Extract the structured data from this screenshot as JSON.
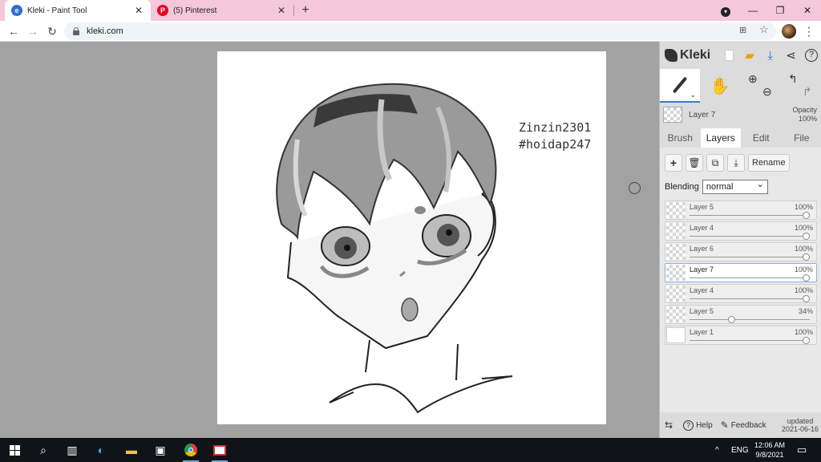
{
  "browser": {
    "tabs": [
      {
        "title": "Kleki - Paint Tool",
        "favicon": "kleki-favicon",
        "active": true
      },
      {
        "title": "(5) Pinterest",
        "favicon": "pinterest-favicon",
        "active": false
      }
    ],
    "url": "kleki.com",
    "accent_color": "#f4c7da"
  },
  "canvas": {
    "watermark_line1": "Zinzin2301",
    "watermark_line2": "#hoidap247"
  },
  "panel": {
    "logo_text": "Kleki",
    "current_layer": "Layer 7",
    "opacity_label": "Opacity",
    "opacity_value": "100%",
    "tabs": [
      "Brush",
      "Layers",
      "Edit",
      "File"
    ],
    "active_tab": "Layers",
    "rename_label": "Rename",
    "blending_label": "Blending",
    "blending_value": "normal",
    "layers": [
      {
        "name": "Layer 5",
        "opacity": "100%",
        "level": 1.0,
        "thumb": "checker"
      },
      {
        "name": "Layer 4",
        "opacity": "100%",
        "level": 1.0,
        "thumb": "checker"
      },
      {
        "name": "Layer 6",
        "opacity": "100%",
        "level": 1.0,
        "thumb": "checker"
      },
      {
        "name": "Layer 7",
        "opacity": "100%",
        "level": 1.0,
        "thumb": "checker",
        "selected": true
      },
      {
        "name": "Layer 4",
        "opacity": "100%",
        "level": 1.0,
        "thumb": "checker"
      },
      {
        "name": "Layer 5",
        "opacity": "34%",
        "level": 0.34,
        "thumb": "checker"
      },
      {
        "name": "Layer 1",
        "opacity": "100%",
        "level": 1.0,
        "thumb": "white"
      }
    ],
    "footer": {
      "help_label": "Help",
      "feedback_label": "Feedback",
      "updated_label": "updated",
      "updated_date": "2021-06-16"
    }
  },
  "taskbar": {
    "language": "ENG",
    "time": "12:06 AM",
    "date": "9/8/2021"
  }
}
